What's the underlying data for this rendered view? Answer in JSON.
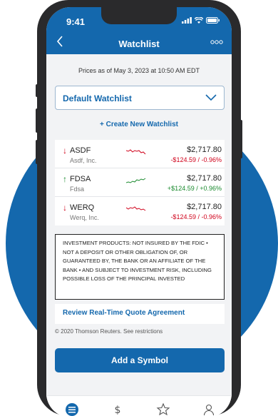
{
  "status_bar": {
    "time": "9:41"
  },
  "nav": {
    "title": "Watchlist"
  },
  "prices_asof": "Prices as of May 3, 2023 at 10:50 AM EDT",
  "watchlist": {
    "selected": "Default Watchlist",
    "create_label": "+ Create New Watchlist"
  },
  "rows": [
    {
      "arrow": "↓",
      "symbol": "ASDF",
      "name": "Asdf, Inc.",
      "price": "$2,717.80",
      "change": "-$124.59 / -0.96%",
      "direction": "down"
    },
    {
      "arrow": "↑",
      "symbol": "FDSA",
      "name": "Fdsa",
      "price": "$2,717.80",
      "change": "+$124.59 / +0.96%",
      "direction": "up"
    },
    {
      "arrow": "↓",
      "symbol": "WERQ",
      "name": "Werq, Inc.",
      "price": "$2,717.80",
      "change": "-$124.59 / -0.96%",
      "direction": "down"
    }
  ],
  "disclaimer": "INVESTMENT PRODUCTS: NOT INSURED BY THE FDIC • NOT A DEPOSIT OR OTHER OBLIGATION OF, OR GUARANTEED BY, THE BANK OR AN AFFILIATE OF THE BANK • AND SUBJECT TO INVESTMENT RISK, INCLUDING POSSIBLE LOSS OF THE PRINCIPAL INVESTED",
  "review_link": "Review Real-Time Quote Agreement",
  "copyright": "© 2020 Thomson Reuters. See restrictions",
  "add_button": "Add a Symbol",
  "colors": {
    "brand": "#1468ad",
    "down": "#d0021b",
    "up": "#1a8a2e"
  },
  "icons": [
    "back-chevron-icon",
    "more-icon",
    "chevron-down-icon",
    "list-icon",
    "dollar-icon",
    "star-icon",
    "person-icon"
  ]
}
